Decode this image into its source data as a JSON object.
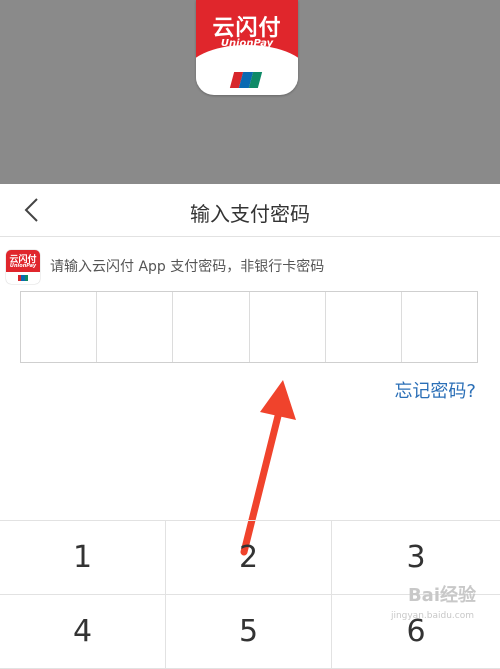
{
  "app_logo": {
    "cn_text": "云闪付",
    "en_text": "UnionPay"
  },
  "header": {
    "title": "输入支付密码",
    "back_icon": "chevron-left-icon"
  },
  "hint": {
    "text": "请输入云闪付 App 支付密码，非银行卡密码"
  },
  "pin": {
    "length": 6
  },
  "forgot_label": "忘记密码?",
  "keypad": {
    "keys": [
      "1",
      "2",
      "3",
      "4",
      "5",
      "6"
    ]
  },
  "watermark": {
    "main": "Bai经验",
    "sub": "jingyan.baidu.com"
  },
  "colors": {
    "brand_red": "#e0262c",
    "link_blue": "#2b6fb7",
    "arrow": "#f0432c",
    "overlay": "#8a8a8a"
  }
}
